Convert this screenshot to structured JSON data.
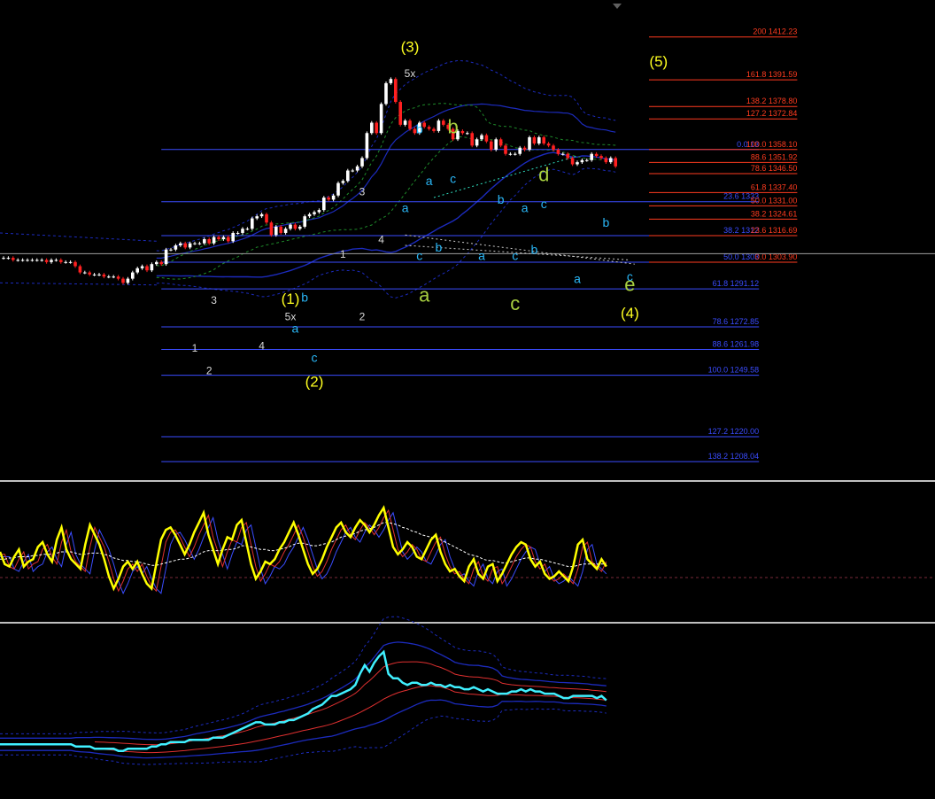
{
  "colors": {
    "background": "#000000",
    "bull_candle": "#ffffff",
    "bear_candle": "#ff2020",
    "fib_blue": "#3a4cff",
    "fib_red": "#ff3b1f",
    "channel_blue": "#1c2bbd",
    "channel_green": "#1e8a2a",
    "trend_cyan": "#30e0c0",
    "wave_yellow": "#ffff20",
    "wave_green": "#a8d040",
    "wave_cyan": "#29b6f6",
    "wave_white": "#d8d8d8",
    "osc_main": "#ffff00",
    "osc_signal": "#ffffff",
    "osc_blue": "#3a4cff",
    "osc_red": "#e03030",
    "ind2_main": "#40f0ff",
    "separator": "#c0c0c0",
    "current_price": "#a0a0a0"
  },
  "chart_data": {
    "type": "line",
    "title": "",
    "main_panel": {
      "price_range": [
        1200,
        1430
      ],
      "current_price": 1308,
      "price_series": [
        1306,
        1306,
        1305,
        1305,
        1305,
        1305,
        1305,
        1305,
        1305,
        1304,
        1305,
        1305,
        1304,
        1304,
        1304,
        1302,
        1299,
        1299,
        1298,
        1298,
        1298,
        1297,
        1297,
        1297,
        1296,
        1294,
        1296,
        1299,
        1301,
        1302,
        1300,
        1303,
        1304,
        1303,
        1310,
        1310,
        1312,
        1313,
        1311,
        1313,
        1313,
        1313,
        1315,
        1313,
        1316,
        1315,
        1316,
        1314,
        1318,
        1318,
        1320,
        1320,
        1325,
        1326,
        1327,
        1323,
        1317,
        1321,
        1318,
        1320,
        1322,
        1320,
        1321,
        1326,
        1327,
        1328,
        1329,
        1335,
        1334,
        1336,
        1342,
        1343,
        1348,
        1348,
        1350,
        1354,
        1366,
        1371,
        1366,
        1380,
        1390,
        1392,
        1381,
        1370,
        1372,
        1368,
        1366,
        1371,
        1369,
        1368,
        1367,
        1372,
        1370,
        1368,
        1363,
        1367,
        1366,
        1366,
        1360,
        1363,
        1365,
        1362,
        1358,
        1363,
        1360,
        1356,
        1356,
        1356,
        1359,
        1358,
        1364,
        1361,
        1364,
        1361,
        1360,
        1358,
        1356,
        1356,
        1354,
        1351,
        1352,
        1353,
        1353,
        1356,
        1355,
        1354,
        1352,
        1354,
        1350
      ],
      "fib_levels_blue": [
        {
          "label": "0.0 13",
          "price": 1358.1
        },
        {
          "label": "23.6 1333",
          "price": 1333.0
        },
        {
          "label": "38.2 1312",
          "price": 1316.69
        },
        {
          "label": "50.0 1303",
          "price": 1303.9
        },
        {
          "label": "61.8 1291.12",
          "price": 1291.12
        },
        {
          "label": "78.6 1272.85",
          "price": 1272.85
        },
        {
          "label": "88.6 1261.98",
          "price": 1261.98
        },
        {
          "label": "100.0 1249.58",
          "price": 1249.58
        },
        {
          "label": "127.2 1220.00",
          "price": 1220.0
        },
        {
          "label": "138.2 1208.04",
          "price": 1208.04
        }
      ],
      "fib_levels_red": [
        {
          "label": "200 1412.23",
          "price": 1412.23
        },
        {
          "label": "161.8 1391.59",
          "price": 1391.59
        },
        {
          "label": "138.2 1378.80",
          "price": 1378.8
        },
        {
          "label": "127.2 1372.84",
          "price": 1372.84
        },
        {
          "label": "100.0 1358.10",
          "price": 1358.1
        },
        {
          "label": "88.6 1351.92",
          "price": 1351.92
        },
        {
          "label": "78.6 1346.50",
          "price": 1346.5
        },
        {
          "label": "61.8 1337.40",
          "price": 1337.4
        },
        {
          "label": "50.0 1331.00",
          "price": 1331.0
        },
        {
          "label": "38.2 1324.61",
          "price": 1324.61
        },
        {
          "label": "23.6 1316.69",
          "price": 1316.69
        },
        {
          "label": "0.0 1303.90",
          "price": 1303.9
        }
      ],
      "wave_labels": [
        {
          "text": "(3)",
          "color": "yellow",
          "bar": 85,
          "price": 1405
        },
        {
          "text": "5x",
          "color": "white",
          "bar": 85,
          "price": 1393
        },
        {
          "text": "(1)",
          "color": "yellow",
          "bar": 60,
          "price": 1284
        },
        {
          "text": "5x",
          "color": "white",
          "bar": 60,
          "price": 1276
        },
        {
          "text": "(2)",
          "color": "yellow",
          "bar": 65,
          "price": 1244
        },
        {
          "text": "(4)",
          "color": "yellow",
          "bar": 131,
          "price": 1277
        },
        {
          "text": "(5)",
          "color": "yellow",
          "bar": 137,
          "price": 1398
        },
        {
          "text": "a",
          "color": "green",
          "bar": 88,
          "price": 1285
        },
        {
          "text": "b",
          "color": "green",
          "bar": 94,
          "price": 1366
        },
        {
          "text": "c",
          "color": "green",
          "bar": 107,
          "price": 1281
        },
        {
          "text": "d",
          "color": "green",
          "bar": 113,
          "price": 1343
        },
        {
          "text": "e",
          "color": "green",
          "bar": 131,
          "price": 1290
        },
        {
          "text": "b",
          "color": "cyan",
          "bar": 87,
          "price": 1366
        },
        {
          "text": "a",
          "color": "cyan",
          "bar": 89,
          "price": 1341
        },
        {
          "text": "c",
          "color": "cyan",
          "bar": 94,
          "price": 1342
        },
        {
          "text": "a",
          "color": "cyan",
          "bar": 84,
          "price": 1328
        },
        {
          "text": "c",
          "color": "cyan",
          "bar": 87,
          "price": 1305
        },
        {
          "text": "b",
          "color": "cyan",
          "bar": 91,
          "price": 1309
        },
        {
          "text": "a",
          "color": "cyan",
          "bar": 100,
          "price": 1305
        },
        {
          "text": "b",
          "color": "cyan",
          "bar": 104,
          "price": 1332
        },
        {
          "text": "c",
          "color": "cyan",
          "bar": 107,
          "price": 1305
        },
        {
          "text": "a",
          "color": "cyan",
          "bar": 109,
          "price": 1328
        },
        {
          "text": "c",
          "color": "cyan",
          "bar": 113,
          "price": 1330
        },
        {
          "text": "b",
          "color": "cyan",
          "bar": 111,
          "price": 1308
        },
        {
          "text": "a",
          "color": "cyan",
          "bar": 120,
          "price": 1294
        },
        {
          "text": "b",
          "color": "cyan",
          "bar": 126,
          "price": 1321
        },
        {
          "text": "c",
          "color": "cyan",
          "bar": 131,
          "price": 1295
        },
        {
          "text": "a",
          "color": "cyan",
          "bar": 61,
          "price": 1270
        },
        {
          "text": "b",
          "color": "cyan",
          "bar": 63,
          "price": 1285
        },
        {
          "text": "c",
          "color": "cyan",
          "bar": 65,
          "price": 1256
        },
        {
          "text": "3",
          "color": "white",
          "bar": 44,
          "price": 1284
        },
        {
          "text": "1",
          "color": "white",
          "bar": 40,
          "price": 1261
        },
        {
          "text": "2",
          "color": "white",
          "bar": 43,
          "price": 1250
        },
        {
          "text": "4",
          "color": "white",
          "bar": 54,
          "price": 1262
        },
        {
          "text": "1",
          "color": "white",
          "bar": 71,
          "price": 1306
        },
        {
          "text": "2",
          "color": "white",
          "bar": 75,
          "price": 1276
        },
        {
          "text": "3",
          "color": "white",
          "bar": 75,
          "price": 1336
        },
        {
          "text": "4",
          "color": "white",
          "bar": 79,
          "price": 1313
        }
      ]
    },
    "oscillator_panel": {
      "main": [
        50,
        40,
        38,
        46,
        52,
        38,
        42,
        44,
        54,
        58,
        48,
        42,
        60,
        70,
        52,
        44,
        40,
        36,
        56,
        72,
        64,
        56,
        44,
        30,
        20,
        28,
        38,
        42,
        36,
        42,
        32,
        24,
        20,
        40,
        60,
        68,
        70,
        64,
        56,
        48,
        56,
        66,
        74,
        82,
        64,
        52,
        40,
        52,
        62,
        60,
        72,
        76,
        58,
        40,
        28,
        34,
        42,
        40,
        44,
        52,
        58,
        66,
        74,
        64,
        52,
        40,
        32,
        36,
        44,
        54,
        62,
        70,
        74,
        66,
        62,
        70,
        76,
        72,
        66,
        72,
        80,
        86,
        70,
        54,
        48,
        52,
        58,
        54,
        46,
        44,
        52,
        60,
        64,
        50,
        40,
        34,
        36,
        30,
        26,
        38,
        44,
        32,
        28,
        38,
        40,
        26,
        32,
        40,
        48,
        54,
        58,
        56,
        44,
        38,
        42,
        32,
        28,
        30,
        34,
        30,
        26,
        38,
        56,
        60,
        44,
        40,
        36,
        44,
        38
      ],
      "signal": [
        44,
        44,
        45,
        45,
        46,
        46,
        46,
        47,
        47,
        48,
        48,
        48,
        49,
        50,
        50,
        50,
        49,
        48,
        48,
        49,
        49,
        49,
        48,
        47,
        45,
        44,
        43,
        43,
        42,
        42,
        41,
        40,
        39,
        39,
        40,
        41,
        42,
        43,
        44,
        44,
        45,
        46,
        48,
        50,
        51,
        51,
        51,
        51,
        52,
        52,
        53,
        55,
        55,
        54,
        53,
        52,
        52,
        51,
        51,
        52,
        53,
        54,
        56,
        57,
        57,
        56,
        55,
        55,
        56,
        57,
        58,
        60,
        62,
        63,
        64,
        65,
        67,
        68,
        69,
        70,
        72,
        74,
        74,
        73,
        72,
        70,
        69,
        67,
        66,
        64,
        63,
        62,
        61,
        60,
        58,
        56,
        54,
        52,
        50,
        48,
        47,
        46,
        44,
        43,
        43,
        42,
        41,
        41,
        42,
        43,
        44,
        45,
        45,
        44,
        44,
        43,
        42,
        41,
        40,
        39,
        38,
        38,
        39,
        40,
        40,
        40,
        40,
        40,
        40
      ]
    },
    "indicator_panel": {
      "main": [
        50,
        50,
        50,
        50,
        50,
        50,
        50,
        50,
        50,
        50,
        50,
        50,
        50,
        50,
        50,
        50,
        49,
        49,
        49,
        49,
        48,
        48,
        48,
        48,
        48,
        47,
        47,
        48,
        48,
        48,
        48,
        48,
        49,
        49,
        50,
        50,
        51,
        51,
        51,
        51,
        52,
        52,
        52,
        52,
        52,
        53,
        53,
        53,
        54,
        55,
        56,
        57,
        58,
        59,
        60,
        60,
        59,
        59,
        59,
        60,
        60,
        61,
        61,
        62,
        63,
        64,
        66,
        67,
        68,
        70,
        72,
        72,
        73,
        74,
        75,
        77,
        82,
        86,
        83,
        87,
        90,
        92,
        82,
        80,
        80,
        78,
        77,
        78,
        78,
        77,
        77,
        78,
        77,
        77,
        76,
        77,
        76,
        76,
        75,
        75,
        76,
        75,
        74,
        75,
        74,
        73,
        73,
        73,
        74,
        74,
        75,
        74,
        75,
        74,
        74,
        73,
        73,
        73,
        72,
        71,
        71,
        72,
        72,
        72,
        72,
        72,
        71,
        72,
        70
      ]
    }
  }
}
